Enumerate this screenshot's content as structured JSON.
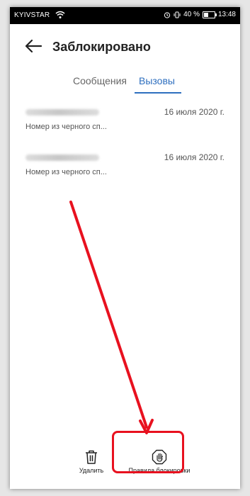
{
  "status_bar": {
    "carrier": "KYIVSTAR",
    "battery_text": "40 %",
    "battery_level": 0.4,
    "time": "13:48"
  },
  "header": {
    "title": "Заблокировано"
  },
  "tabs": [
    {
      "label": "Сообщения",
      "active": false
    },
    {
      "label": "Вызовы",
      "active": true
    }
  ],
  "entries": [
    {
      "date": "16 июля 2020 г.",
      "subtitle": "Номер из черного сп..."
    },
    {
      "date": "16 июля 2020 г.",
      "subtitle": "Номер из черного сп..."
    }
  ],
  "bottom_bar": {
    "delete_label": "Удалить",
    "rules_label": "Правила блокировки"
  },
  "colors": {
    "accent": "#2e6fbf",
    "annotation": "#e8111f"
  }
}
